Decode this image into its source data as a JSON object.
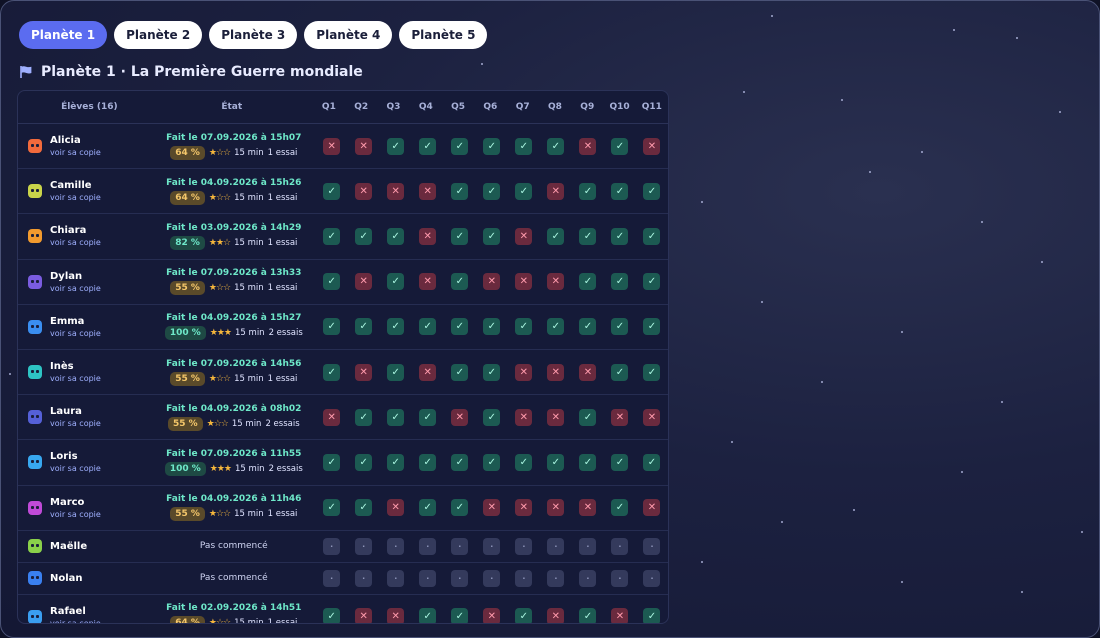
{
  "tabs": [
    "Planète 1",
    "Planète 2",
    "Planète 3",
    "Planète 4",
    "Planète 5"
  ],
  "active_tab": 0,
  "title": "Planète 1 · La Première Guerre mondiale",
  "headers": {
    "students": "Élèves (16)",
    "state": "État",
    "questions": [
      "Q1",
      "Q2",
      "Q3",
      "Q4",
      "Q5",
      "Q6",
      "Q7",
      "Q8",
      "Q9",
      "Q10",
      "Q11"
    ]
  },
  "link_label": "voir sa copie",
  "not_started_label": "Pas commencé",
  "students": [
    {
      "name": "Alicia",
      "avatar_color": "#f26a3c",
      "done": "Fait le 07.09.2026 à 15h07",
      "score": "64 %",
      "level": "mid",
      "stars": "★☆☆",
      "stars_half": true,
      "time": "15 min",
      "tries": "1 essai",
      "answers": "xxooooooxox"
    },
    {
      "name": "Camille",
      "avatar_color": "#c9d44a",
      "done": "Fait le 04.09.2026 à 15h26",
      "score": "64 %",
      "level": "mid",
      "stars": "★☆☆",
      "time": "15 min",
      "tries": "1 essai",
      "answers": "oxxxoooxooo"
    },
    {
      "name": "Chiara",
      "avatar_color": "#f29a2e",
      "done": "Fait le 03.09.2026 à 14h29",
      "score": "82 %",
      "level": "good",
      "stars": "★★☆",
      "time": "15 min",
      "tries": "1 essai",
      "answers": "oooxooxoooo"
    },
    {
      "name": "Dylan",
      "avatar_color": "#7a5ce0",
      "done": "Fait le 07.09.2026 à 13h33",
      "score": "55 %",
      "level": "mid",
      "stars": "★☆☆",
      "time": "15 min",
      "tries": "1 essai",
      "answers": "oxoxoxxxooo"
    },
    {
      "name": "Emma",
      "avatar_color": "#3a8ef0",
      "done": "Fait le 04.09.2026 à 15h27",
      "score": "100 %",
      "level": "good",
      "stars": "★★★",
      "time": "15 min",
      "tries": "2 essais",
      "answers": "ooooooooooo"
    },
    {
      "name": "Inès",
      "avatar_color": "#2ec4c4",
      "done": "Fait le 07.09.2026 à 14h56",
      "score": "55 %",
      "level": "mid",
      "stars": "★☆☆",
      "time": "15 min",
      "tries": "1 essai",
      "answers": "oxoxooxxxoo"
    },
    {
      "name": "Laura",
      "avatar_color": "#5560d8",
      "done": "Fait le 04.09.2026 à 08h02",
      "score": "55 %",
      "level": "mid",
      "stars": "★☆☆",
      "time": "15 min",
      "tries": "2 essais",
      "answers": "xoooxoxxoxx"
    },
    {
      "name": "Loris",
      "avatar_color": "#38a8f0",
      "done": "Fait le 07.09.2026 à 11h55",
      "score": "100 %",
      "level": "good",
      "stars": "★★★",
      "time": "15 min",
      "tries": "2 essais",
      "answers": "ooooooooooo"
    },
    {
      "name": "Marco",
      "avatar_color": "#c04ad8",
      "done": "Fait le 04.09.2026 à 11h46",
      "score": "55 %",
      "level": "mid",
      "stars": "★☆☆",
      "time": "15 min",
      "tries": "1 essai",
      "answers": "ooxooxxxxox"
    },
    {
      "name": "Maëlle",
      "avatar_color": "#8ad04a",
      "not_started": true
    },
    {
      "name": "Nolan",
      "avatar_color": "#3a80f0",
      "not_started": true
    },
    {
      "name": "Rafael",
      "avatar_color": "#3a9ef0",
      "done": "Fait le 02.09.2026 à 14h51",
      "score": "64 %",
      "level": "mid",
      "stars": "★☆☆",
      "time": "15 min",
      "tries": "1 essai",
      "answers": "oxxooxoxoxo"
    }
  ]
}
